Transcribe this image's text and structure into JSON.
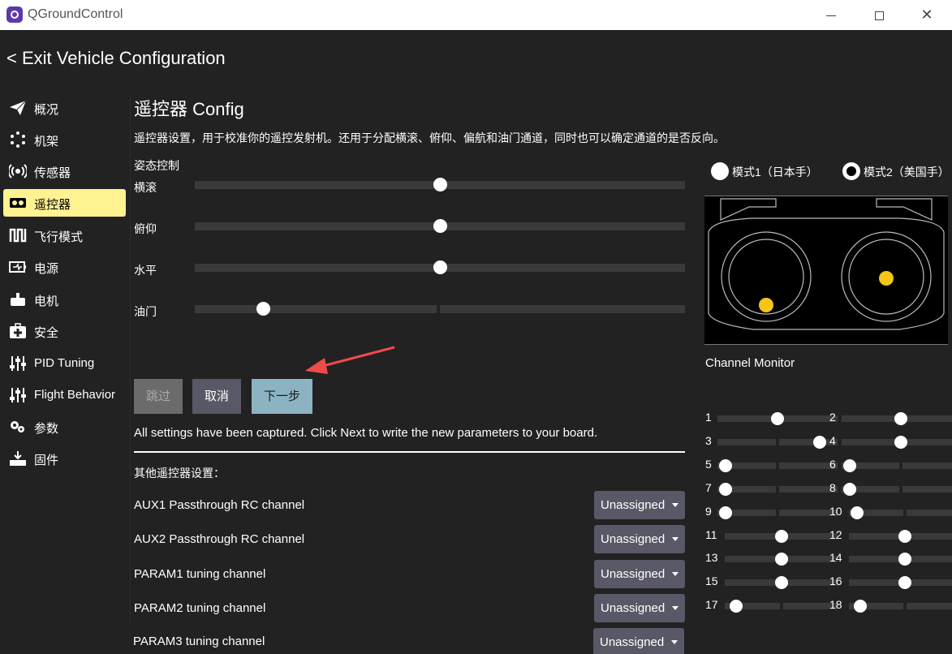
{
  "window": {
    "title": "QGroundControl"
  },
  "nav": {
    "exit_label": "< Exit Vehicle Configuration"
  },
  "sidebar": {
    "items": [
      {
        "label": "概况",
        "icon": "paper-plane-icon"
      },
      {
        "label": "机架",
        "icon": "airframe-icon"
      },
      {
        "label": "传感器",
        "icon": "sensor-icon"
      },
      {
        "label": "遥控器",
        "icon": "remote-control-icon",
        "active": true
      },
      {
        "label": "飞行模式",
        "icon": "flight-modes-icon"
      },
      {
        "label": "电源",
        "icon": "battery-icon"
      },
      {
        "label": "电机",
        "icon": "motor-icon"
      },
      {
        "label": "安全",
        "icon": "safety-icon"
      },
      {
        "label": "PID Tuning",
        "icon": "pid-tuning-icon"
      },
      {
        "label": "Flight Behavior",
        "icon": "flight-behavior-icon"
      },
      {
        "label": "参数",
        "icon": "parameters-icon"
      },
      {
        "label": "固件",
        "icon": "firmware-icon"
      }
    ]
  },
  "page": {
    "title": "遥控器 Config",
    "description": "遥控器设置，用于校准你的遥控发射机。还用于分配横滚、俯仰、偏航和油门通道，同时也可以确定通道的是否反向。",
    "attitude_label": "姿态控制",
    "axes": [
      {
        "label": "横滚",
        "value": 0.5
      },
      {
        "label": "俯仰",
        "value": 0.5
      },
      {
        "label": "水平",
        "value": 0.5
      },
      {
        "label": "油门",
        "value": 0.14
      }
    ],
    "buttons": {
      "skip": "跳过",
      "cancel": "取消",
      "next": "下一步"
    },
    "captured_message": "All settings have been captured. Click Next to write the new parameters to your board.",
    "other_label": "其他遥控器设置：",
    "options": [
      {
        "label": "AUX1 Passthrough RC channel",
        "value": "Unassigned"
      },
      {
        "label": "AUX2 Passthrough RC channel",
        "value": "Unassigned"
      },
      {
        "label": "PARAM1 tuning channel",
        "value": "Unassigned"
      },
      {
        "label": "PARAM2 tuning channel",
        "value": "Unassigned"
      },
      {
        "label": "PARAM3 tuning channel",
        "value": "Unassigned"
      }
    ]
  },
  "modes": {
    "mode1": "模式1（日本手）",
    "mode2": "模式2（美国手）",
    "selected": "mode2"
  },
  "channel_monitor": {
    "title": "Channel Monitor",
    "channels": [
      {
        "num": "1",
        "value": 0.5
      },
      {
        "num": "2",
        "value": 0.5
      },
      {
        "num": "3",
        "value": 0.85
      },
      {
        "num": "4",
        "value": 0.5
      },
      {
        "num": "5",
        "value": 0.07
      },
      {
        "num": "6",
        "value": 0.07
      },
      {
        "num": "7",
        "value": 0.07
      },
      {
        "num": "8",
        "value": 0.07
      },
      {
        "num": "9",
        "value": 0.07
      },
      {
        "num": "10",
        "value": 0.07
      },
      {
        "num": "11",
        "value": 0.5
      },
      {
        "num": "12",
        "value": 0.5
      },
      {
        "num": "13",
        "value": 0.5
      },
      {
        "num": "14",
        "value": 0.5
      },
      {
        "num": "15",
        "value": 0.5
      },
      {
        "num": "16",
        "value": 0.5
      },
      {
        "num": "17",
        "value": 0.1
      },
      {
        "num": "18",
        "value": 0.1
      }
    ]
  },
  "colors": {
    "accent": "#fff291",
    "stick": "#f5c518",
    "next_button": "#8cb3c2",
    "arrow": "#ef4b4b"
  }
}
